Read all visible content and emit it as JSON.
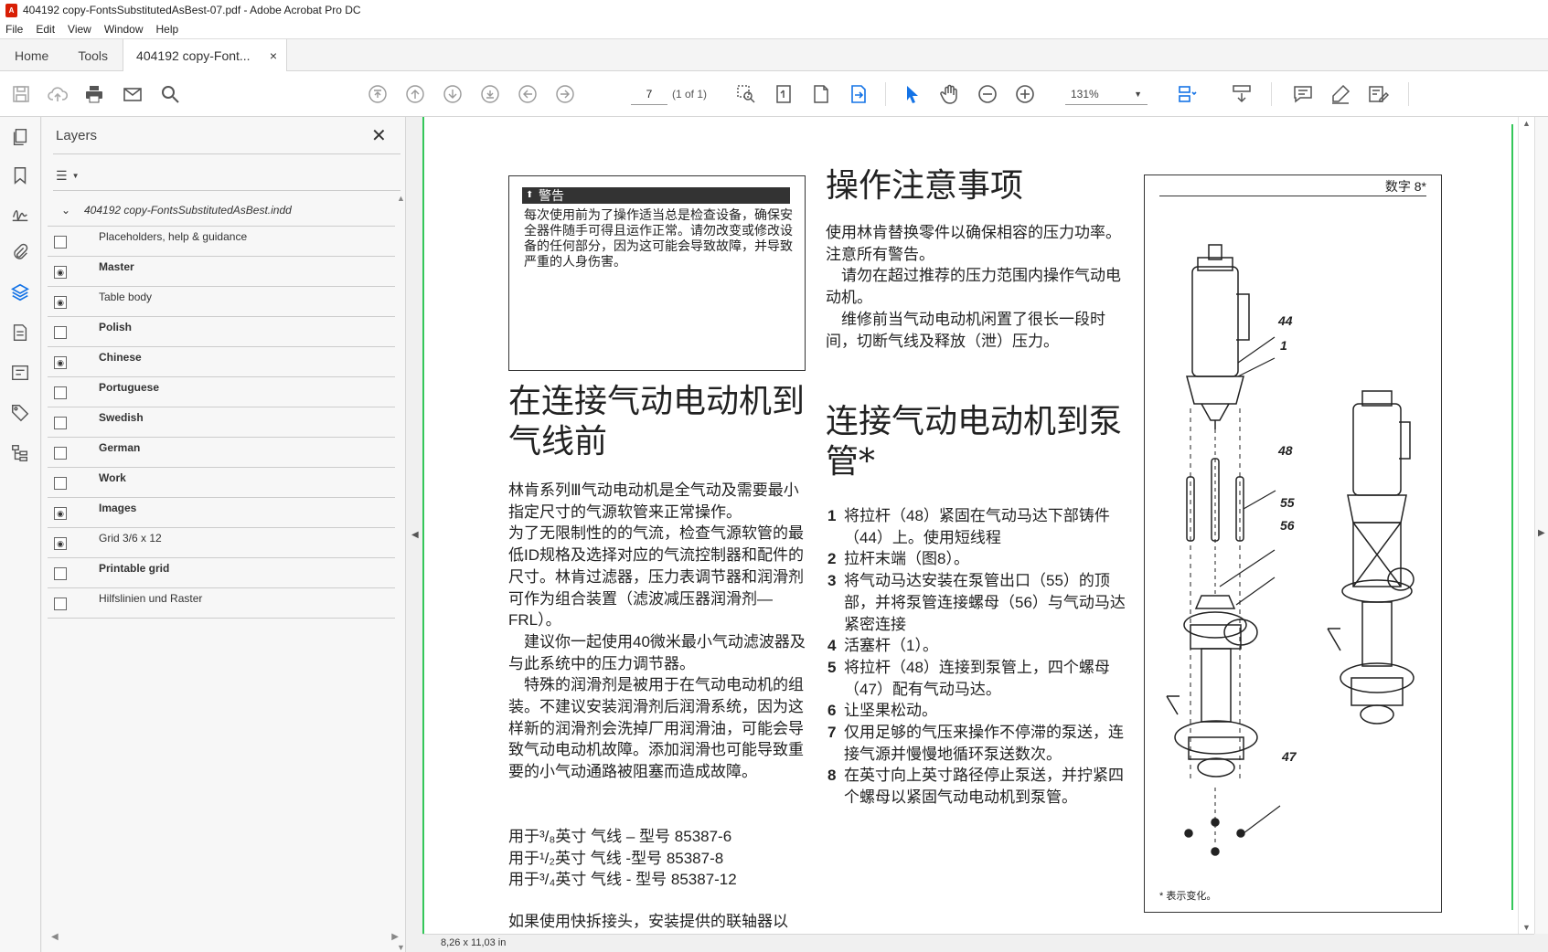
{
  "window": {
    "title": "404192 copy-FontsSubstitutedAsBest-07.pdf - Adobe Acrobat Pro DC"
  },
  "menu": [
    "File",
    "Edit",
    "View",
    "Window",
    "Help"
  ],
  "tabs": {
    "home": "Home",
    "tools": "Tools",
    "doc": "404192 copy-Font...",
    "close": "×"
  },
  "toolbar": {
    "page_current": "7",
    "page_of": "(1 of 1)",
    "zoom": "131%"
  },
  "layers": {
    "title": "Layers",
    "root": "404192 copy-FontsSubstitutedAsBest.indd",
    "items": [
      {
        "name": "Placeholders, help & guidance",
        "visible": false,
        "bold": false
      },
      {
        "name": "Master",
        "visible": true,
        "bold": true
      },
      {
        "name": "Table body",
        "visible": true,
        "bold": false
      },
      {
        "name": "Polish",
        "visible": false,
        "bold": true
      },
      {
        "name": "Chinese",
        "visible": true,
        "bold": true
      },
      {
        "name": "Portuguese",
        "visible": false,
        "bold": true
      },
      {
        "name": "Swedish",
        "visible": false,
        "bold": true
      },
      {
        "name": "German",
        "visible": false,
        "bold": true
      },
      {
        "name": "Work",
        "visible": false,
        "bold": true
      },
      {
        "name": "Images",
        "visible": true,
        "bold": true
      },
      {
        "name": "Grid 3/6 x 12",
        "visible": true,
        "bold": false
      },
      {
        "name": "Printable grid",
        "visible": false,
        "bold": true
      },
      {
        "name": "Hilfslinien und Raster",
        "visible": false,
        "bold": false
      }
    ]
  },
  "status": {
    "page_size": "8,26 x 11,03 in"
  },
  "doc": {
    "warning_title": "警告",
    "warning_text": "每次使用前为了操作适当总是检查设备，确保安全器件随手可得且运作正常。请勿改变或修改设备的任何部分，因为这可能会导致故障，并导致严重的人身伤害。",
    "h_before": "在连接气动电动机到气线前",
    "para_before": [
      "林肯系列Ⅲ气动电动机是全气动及需要最小指定尺寸的气源软管来正常操作。",
      "为了无限制性的的气流，检查气源软管的最低ID规格及选择对应的气流控制器和配件的尺寸。林肯过滤器，压力表调节器和润滑剂可作为组合装置（滤波减压器润滑剂—FRL）。",
      "　建议你一起使用40微米最小气动滤波器及与此系统中的压力调节器。",
      "　特殊的润滑剂是被用于在气动电动机的组装。不建议安装润滑剂后润滑系统，因为这样新的润滑剂会洗掉厂用润滑油，可能会导致气动电动机故障。添加润滑也可能导致重要的小气动通路被阻塞而造成故障。"
    ],
    "models": [
      "用于³/₈英寸 气线 – 型号 85387-6",
      "用于¹/₂英寸 气线 -型号  85387-8",
      "用于³/₄英寸 气线 - 型号 85387-12"
    ],
    "quick": "如果使用快拆接头，安装提供的联轴器以",
    "h_ops": "操作注意事项",
    "para_ops": [
      "使用林肯替换零件以确保相容的压力功率。注意所有警告。",
      "　请勿在超过推荐的压力范围内操作气动电动机。",
      "　维修前当气动电动机闲置了很长一段时间，切断气线及释放（泄）压力。"
    ],
    "h_connect": "连接气动电动机到泵管*",
    "steps": [
      {
        "n": "1",
        "t": "将拉杆（48）紧固在气动马达下部铸件（44）上。使用短线程"
      },
      {
        "n": "2",
        "t": "拉杆末端（图8）。"
      },
      {
        "n": "3",
        "t": "将气动马达安装在泵管出口（55）的顶部，并将泵管连接螺母（56）与气动马达紧密连接"
      },
      {
        "n": "4",
        "t": "活塞杆（1）。"
      },
      {
        "n": "5",
        "t": "将拉杆（48）连接到泵管上，四个螺母（47）配有气动马达。"
      },
      {
        "n": "6",
        "t": "让坚果松动。"
      },
      {
        "n": "7",
        "t": "仅用足够的气压来操作不停滞的泵送，连接气源并慢慢地循环泵送数次。"
      },
      {
        "n": "8",
        "t": "在英寸向上英寸路径停止泵送，并拧紧四个螺母以紧固气动电动机到泵管。"
      }
    ],
    "fig_title": "数字 8*",
    "fig_note": "*  表示变化。",
    "fig_labels": [
      "44",
      "1",
      "48",
      "55",
      "56",
      "47"
    ]
  }
}
